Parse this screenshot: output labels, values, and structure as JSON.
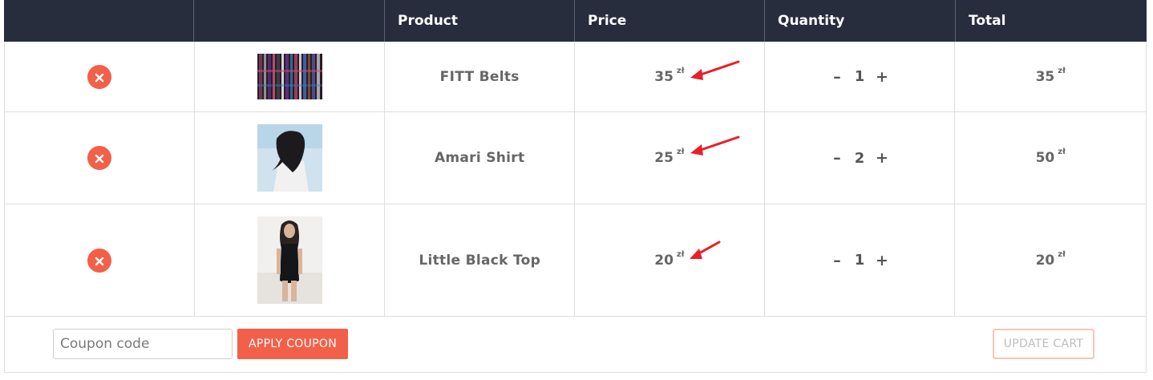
{
  "table": {
    "headers": [
      "",
      "",
      "Product",
      "Price",
      "Quantity",
      "Total"
    ]
  },
  "items": [
    {
      "name": "FITT Belts",
      "price": "35",
      "total": "35",
      "quantity": "1",
      "image": "belts-thumbnail"
    },
    {
      "name": "Amari Shirt",
      "price": "25",
      "total": "50",
      "quantity": "2",
      "image": "shirt-thumbnail"
    },
    {
      "name": "Little Black Top",
      "price": "20",
      "total": "20",
      "quantity": "1",
      "image": "black-top-thumbnail"
    }
  ],
  "currency": "zł",
  "controls": {
    "decrease": "–",
    "increase": "+",
    "remove_icon": "close-icon"
  },
  "footer": {
    "coupon_placeholder": "Coupon code",
    "coupon_value": "",
    "apply_label": "APPLY COUPON",
    "update_label": "UPDATE CART"
  },
  "colors": {
    "header_bg": "#272d3d",
    "accent": "#f26049",
    "annotation_arrow": "#e8202a"
  }
}
